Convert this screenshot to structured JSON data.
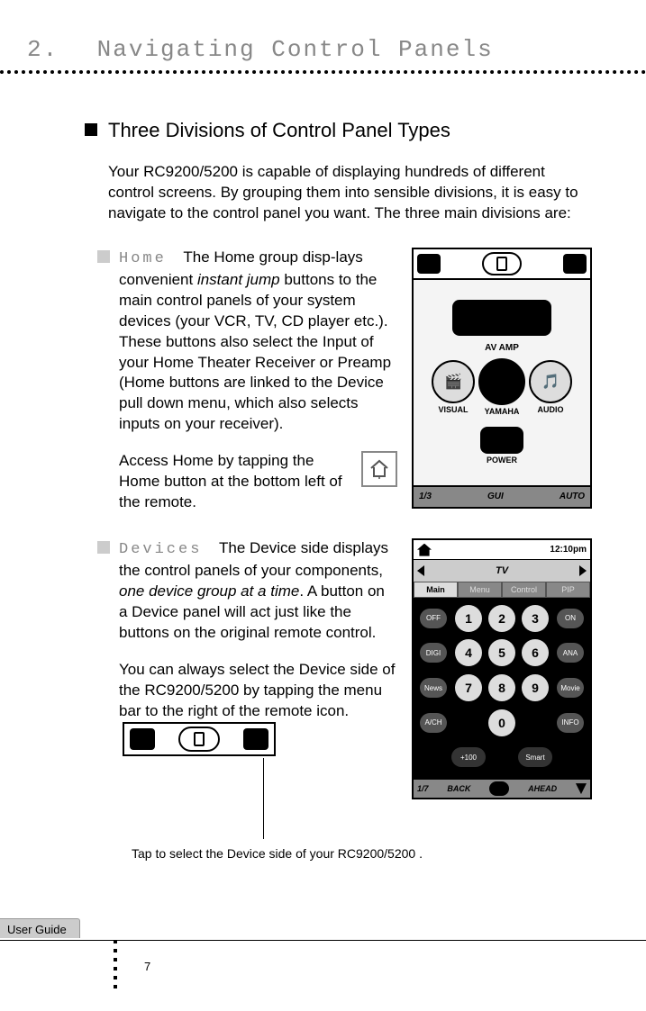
{
  "chapter": {
    "number": "2.",
    "title": "Navigating Control Panels"
  },
  "section_title": "Three Divisions of Control Panel Types",
  "intro": "Your RC9200/5200 is capable of displaying hundreds of different control screens. By grouping them into sensible divisions, it is easy to navigate to the control panel you want. The three main divisions are:",
  "home": {
    "label": "Home",
    "main_text_a": "The Home group disp-lays convenient ",
    "italic_a": "instant jump",
    "main_text_b": " buttons to the main control panels of your system devices (your VCR, TV, CD player etc.). These buttons also select the Input of your Home Theater Receiver or Preamp (Home buttons are linked to the Device pull down menu, which also selects inputs on your receiver).",
    "access_text": "Access Home by tapping the Home button at the bottom left of the remote.",
    "screenshot": {
      "amp_label": "AV AMP",
      "labels": [
        "VISUAL",
        "YAMAHA",
        "AUDIO"
      ],
      "power_label": "POWER",
      "footer": {
        "left": "1/3",
        "mid": "GUI",
        "right": "AUTO"
      }
    }
  },
  "devices": {
    "label": "Devices",
    "main_text_a": "The Device side displays the control panels of your components, ",
    "italic_a": "one device group at a time",
    "main_text_b": ".  A button on a Device panel will act just like the buttons on the original remote control.",
    "para2": "You can always select the Device side of the RC9200/5200  by tapping the menu bar to the right of the remote icon.",
    "callout": "Tap to select the Device side of your RC9200/5200 .",
    "screenshot": {
      "time": "12:10pm",
      "device": "TV",
      "tabs": [
        "Main",
        "Menu",
        "Control",
        "PIP"
      ],
      "side_left": [
        "OFF",
        "DIGI",
        "News",
        "A/CH"
      ],
      "side_right": [
        "ON",
        "ANA",
        "Movie",
        "INFO"
      ],
      "numbers": [
        "1",
        "2",
        "3",
        "4",
        "5",
        "6",
        "7",
        "8",
        "9",
        "0"
      ],
      "wide_left": "+100",
      "wide_right": "Smart",
      "footer": {
        "left": "1/7",
        "back": "BACK",
        "ahead": "AHEAD"
      }
    }
  },
  "footer": {
    "tab": "User Guide",
    "page": "7"
  }
}
